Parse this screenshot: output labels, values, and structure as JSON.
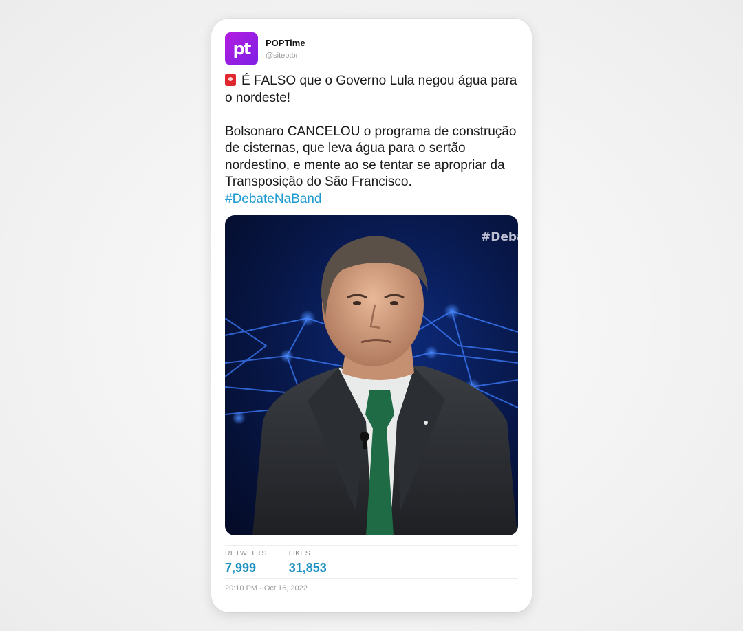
{
  "tweet": {
    "author": {
      "display_name": "POPTime",
      "handle": "@siteptbr",
      "avatar_text": "pt",
      "avatar_color": "#a81de2"
    },
    "text": {
      "line1": "É FALSO que o Governo Lula negou água para o nordeste!",
      "line2": "Bolsonaro CANCELOU o programa de construção de cisternas, que leva água para o sertão nordestino, e mente ao se tentar se apropriar da Transposição do São Francisco.",
      "hashtag": "#DebateNaBand",
      "leading_icon": "siren-icon"
    },
    "media": {
      "watermark": "#Deba"
    },
    "stats": {
      "retweets_label": "RETWEETS",
      "retweets_value": "7,999",
      "likes_label": "LIKES",
      "likes_value": "31,853"
    },
    "timestamp": "20:10 PM - Oct 16, 2022"
  },
  "colors": {
    "hashtag": "#1d9bd1",
    "stat_value": "#1d91c2"
  }
}
